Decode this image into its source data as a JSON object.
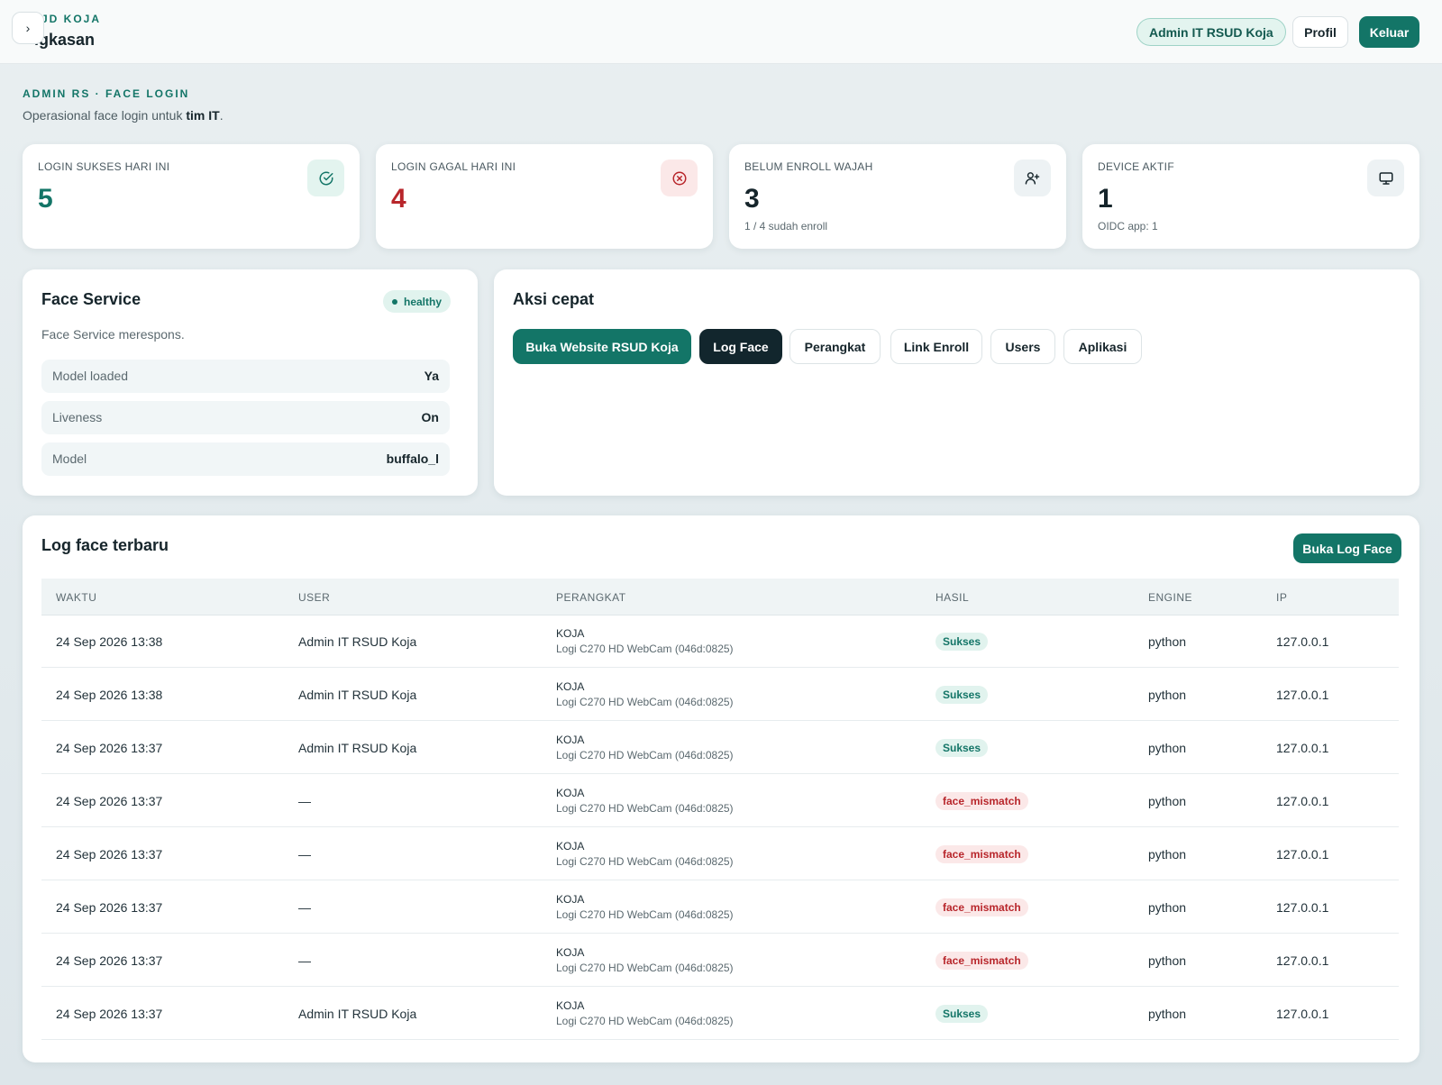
{
  "header": {
    "breadcrumb": "JD KOJA",
    "page_title": "ıgkasan",
    "user_chip": "Admin IT RSUD Koja",
    "profil_label": "Profil",
    "keluar_label": "Keluar",
    "toggle_glyph": "›"
  },
  "intro": {
    "eyebrow": "ADMIN RS · FACE LOGIN",
    "subtitle_pre": "Operasional face login untuk ",
    "subtitle_bold": "tim IT",
    "subtitle_post": "."
  },
  "stats": [
    {
      "label": "LOGIN SUKSES HARI INI",
      "value": "5",
      "sub": "",
      "icon": "check-circle-icon",
      "color": "#137567",
      "icon_bg": "#e3f4ef"
    },
    {
      "label": "LOGIN GAGAL HARI INI",
      "value": "4",
      "sub": "",
      "icon": "x-circle-icon",
      "color": "#b8262b",
      "icon_bg": "#fbe8e8"
    },
    {
      "label": "BELUM ENROLL WAJAH",
      "value": "3",
      "sub": "1 / 4 sudah enroll",
      "icon": "user-plus-icon",
      "color": "#16252b",
      "icon_bg": "#edf2f4"
    },
    {
      "label": "DEVICE AKTIF",
      "value": "1",
      "sub": "OIDC app: 1",
      "icon": "monitor-icon",
      "color": "#16252b",
      "icon_bg": "#edf2f4"
    }
  ],
  "face_service": {
    "title": "Face Service",
    "status": "healthy",
    "description": "Face Service merespons.",
    "rows": [
      {
        "key": "Model loaded",
        "value": "Ya"
      },
      {
        "key": "Liveness",
        "value": "On"
      },
      {
        "key": "Model",
        "value": "buffalo_l"
      }
    ]
  },
  "quick_actions": {
    "title": "Aksi cepat",
    "buttons": [
      {
        "label": "Buka Website RSUD Koja",
        "style": "primary"
      },
      {
        "label": "Log Face",
        "style": "dark"
      },
      {
        "label": "Perangkat",
        "style": "default"
      },
      {
        "label": "Link Enroll",
        "style": "default"
      },
      {
        "label": "Users",
        "style": "default"
      },
      {
        "label": "Aplikasi",
        "style": "default"
      }
    ]
  },
  "log": {
    "title": "Log face terbaru",
    "open_label": "Buka Log Face",
    "columns": [
      "WAKTU",
      "USER",
      "PERANGKAT",
      "HASIL",
      "ENGINE",
      "IP"
    ],
    "rows": [
      {
        "time": "24 Sep 2026 13:38",
        "user": "Admin IT RSUD Koja",
        "device": "KOJA",
        "device_detail": "Logi C270 HD WebCam (046d:0825)",
        "result": "Sukses",
        "ok": true,
        "engine": "python",
        "ip": "127.0.0.1"
      },
      {
        "time": "24 Sep 2026 13:38",
        "user": "Admin IT RSUD Koja",
        "device": "KOJA",
        "device_detail": "Logi C270 HD WebCam (046d:0825)",
        "result": "Sukses",
        "ok": true,
        "engine": "python",
        "ip": "127.0.0.1"
      },
      {
        "time": "24 Sep 2026 13:37",
        "user": "Admin IT RSUD Koja",
        "device": "KOJA",
        "device_detail": "Logi C270 HD WebCam (046d:0825)",
        "result": "Sukses",
        "ok": true,
        "engine": "python",
        "ip": "127.0.0.1"
      },
      {
        "time": "24 Sep 2026 13:37",
        "user": "—",
        "device": "KOJA",
        "device_detail": "Logi C270 HD WebCam (046d:0825)",
        "result": "face_mismatch",
        "ok": false,
        "engine": "python",
        "ip": "127.0.0.1"
      },
      {
        "time": "24 Sep 2026 13:37",
        "user": "—",
        "device": "KOJA",
        "device_detail": "Logi C270 HD WebCam (046d:0825)",
        "result": "face_mismatch",
        "ok": false,
        "engine": "python",
        "ip": "127.0.0.1"
      },
      {
        "time": "24 Sep 2026 13:37",
        "user": "—",
        "device": "KOJA",
        "device_detail": "Logi C270 HD WebCam (046d:0825)",
        "result": "face_mismatch",
        "ok": false,
        "engine": "python",
        "ip": "127.0.0.1"
      },
      {
        "time": "24 Sep 2026 13:37",
        "user": "—",
        "device": "KOJA",
        "device_detail": "Logi C270 HD WebCam (046d:0825)",
        "result": "face_mismatch",
        "ok": false,
        "engine": "python",
        "ip": "127.0.0.1"
      },
      {
        "time": "24 Sep 2026 13:37",
        "user": "Admin IT RSUD Koja",
        "device": "KOJA",
        "device_detail": "Logi C270 HD WebCam (046d:0825)",
        "result": "Sukses",
        "ok": true,
        "engine": "python",
        "ip": "127.0.0.1"
      }
    ]
  }
}
